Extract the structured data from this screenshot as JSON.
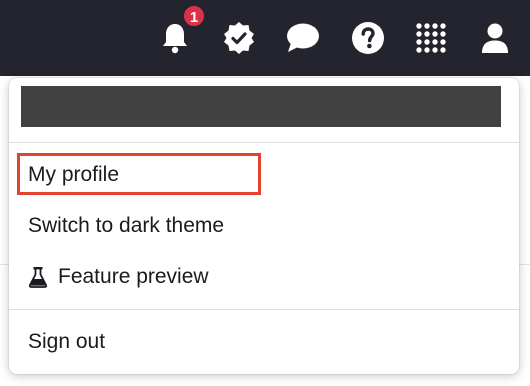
{
  "topbar": {
    "notifications": {
      "icon": "bell-icon",
      "badge_count": "1",
      "badge_color": "#d9324a"
    },
    "icons": [
      "bell-icon",
      "verified-badge-icon",
      "chat-bubble-icon",
      "help-icon",
      "apps-grid-icon",
      "user-icon"
    ],
    "background": "#23242d"
  },
  "menu": {
    "user_bar_color": "#414141",
    "items": [
      {
        "label": "My profile",
        "highlighted": true
      },
      {
        "label": "Switch to dark theme"
      },
      {
        "label": "Feature preview",
        "icon": "flask-icon"
      },
      {
        "label": "Sign out"
      }
    ],
    "highlight_color": "#e2442d"
  }
}
